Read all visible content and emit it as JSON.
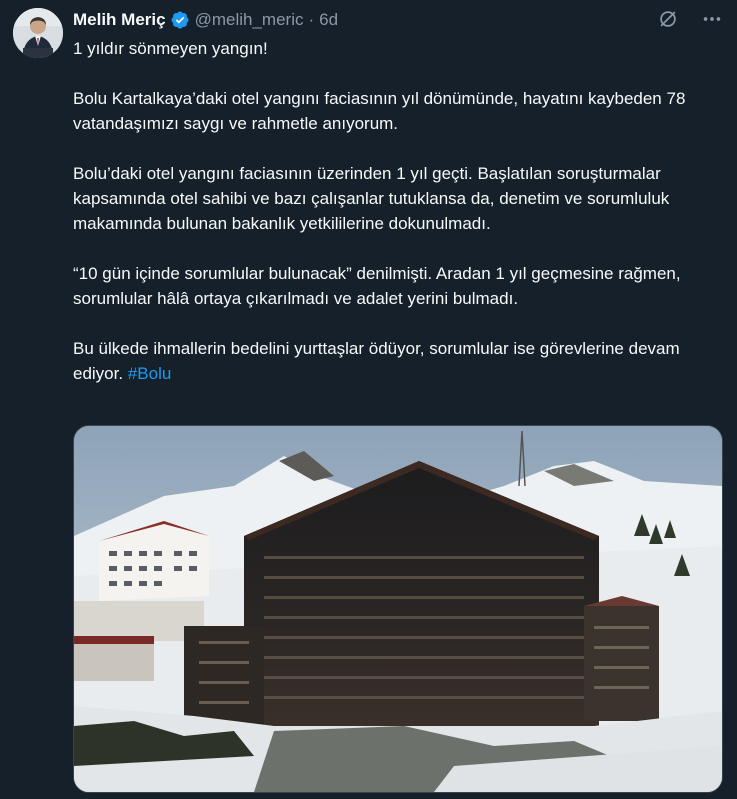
{
  "author": {
    "name": "Melih Meriç",
    "handle": "@melih_meric",
    "separator": "·",
    "time": "6d",
    "verified": true
  },
  "tweet": {
    "line1": "1 yıldır sönmeyen yangın!",
    "paragraph2": "Bolu Kartalkaya’daki otel yangını faciasının yıl dönümünde, hayatını kaybeden 78 vatandaşımızı saygı ve rahmetle anıyorum.",
    "paragraph3": "Bolu’daki otel yangını faciasının üzerinden 1 yıl geçti. Başlatılan soruşturmalar kapsamında otel sahibi ve bazı çalışanlar tutuklansa da, denetim ve sorumluluk makamında bulunan bakanlık yetkililerine dokunulmadı.",
    "paragraph4": "“10 gün içinde sorumlular bulunacak” denilmişti. Aradan 1 yıl geçmesine rağmen, sorumlular hâlâ ortaya çıkarılmadı ve adalet yerini bulmadı.",
    "paragraph5": "Bu ülkede ihmallerin bedelini yurttaşlar ödüyor, sorumlular ise görevlerine devam ediyor.",
    "hashtag": "#Bolu"
  },
  "icons": {
    "verified": "verified-badge-icon",
    "grok": "grok-icon",
    "more": "more-icon"
  },
  "colors": {
    "background": "#15202b",
    "text": "#f7f9f9",
    "secondary": "#8b98a5",
    "accent": "#1d9bf0"
  }
}
